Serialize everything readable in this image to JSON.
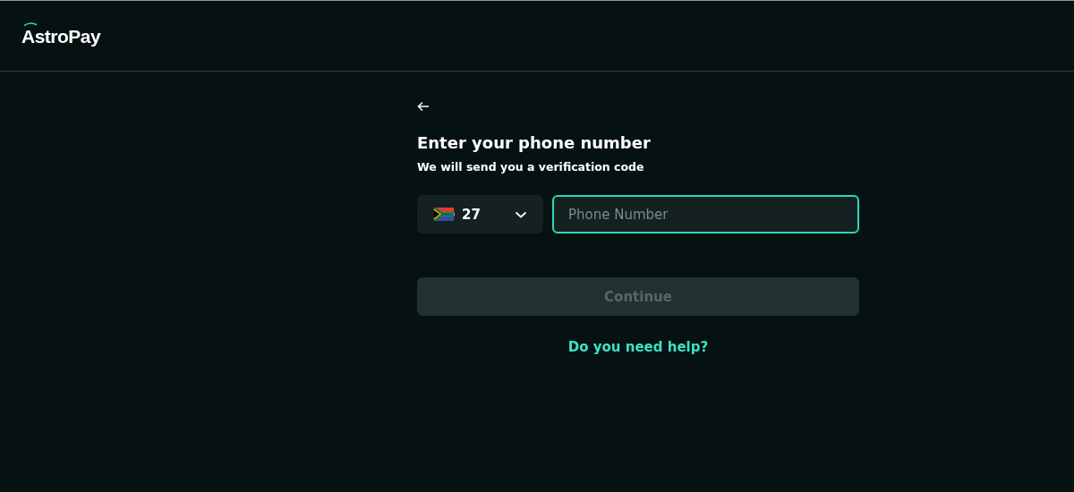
{
  "header": {
    "logo": "AstroPay"
  },
  "heading": "Enter your phone number",
  "subheading": "We will send you a verification code",
  "country_code": {
    "value": "27"
  },
  "phone_field": {
    "placeholder": "Phone Number",
    "focused": true
  },
  "continue_button": {
    "label": "Continue",
    "disabled": true
  },
  "help_link": "Do you need help?"
}
